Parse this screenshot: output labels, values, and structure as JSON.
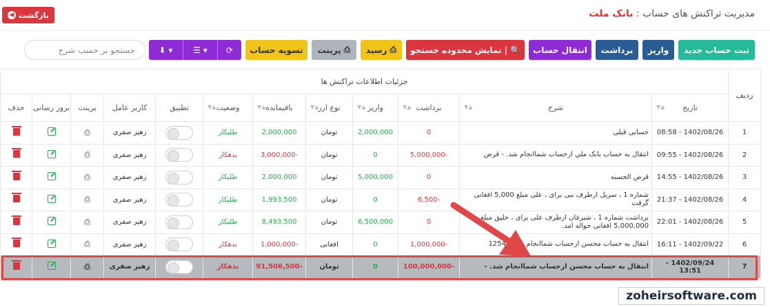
{
  "header": {
    "title_prefix": "مدیریت تراکنش های حساب :",
    "bank_name": "بانک ملت",
    "back_label": "بازگشت"
  },
  "toolbar": {
    "new_account": "ثبت حساب جدید",
    "deposit": "واریز",
    "withdraw": "برداشت",
    "transfer": "انتقال حساب",
    "search_range": "نمایش محدوده جستجو",
    "receipt": "رسید",
    "print": "پرینت",
    "settle": "تسویه حساب",
    "search_placeholder": "جستجو بر حسب شرح"
  },
  "table": {
    "caption": "جزئیات اطلاعات تراکنش ها",
    "columns": {
      "row": "ردیف",
      "date": "تاریخ",
      "description": "شرح",
      "withdraw": "برداشت",
      "deposit": "واریز",
      "currency": "نوع ارز",
      "balance": "باقیمانده",
      "status": "وضعیت",
      "reconcile": "تطبیق",
      "operator": "کاربر عامل",
      "print": "پرینت",
      "update": "بروز رسانی",
      "delete": "حذف"
    },
    "rows": [
      {
        "id": "1",
        "date": "1402/08/26 - 08:58",
        "desc": "حسابی قبلی",
        "withdraw": "0",
        "deposit": "2,000,000",
        "currency": "تومان",
        "balance": "2,000,000",
        "status": "طلبکار",
        "operator": "زهیر صفری"
      },
      {
        "id": "2",
        "date": "1402/08/26 - 09:55",
        "desc": "انتقال به حساب بانک ملي ازحساب شماانجام شد. - قرض",
        "withdraw": "-5,000,000",
        "deposit": "0",
        "currency": "تومان",
        "balance": "-3,000,000",
        "status": "بدهکار",
        "operator": "زهیر صفری"
      },
      {
        "id": "3",
        "date": "1402/08/26 - 14:55",
        "desc": "قرض الحسنه",
        "withdraw": "0",
        "deposit": "5,000,000",
        "currency": "تومان",
        "balance": "2,000,000",
        "status": "طلبکار",
        "operator": "زهیر صفری"
      },
      {
        "id": "4",
        "date": "1402/08/26 - 21:37",
        "desc": "شماره 1 ، سربل ازطرف نبی برای ، علی مبلغ 5,000 افغانی گرفت",
        "withdraw": "-6,500",
        "deposit": "0",
        "currency": "تومان",
        "balance": "1,993,500",
        "status": "طلبکار",
        "operator": "زهیر صفری"
      },
      {
        "id": "5",
        "date": "1402/08/26 - 22:01",
        "desc": "برداشت شماره 1 ، شبرغان ازطرف علی برای ، خلیق مبلغ 5,000,000 افغانی حواله امد.",
        "withdraw": "0",
        "deposit": "6,500,000",
        "currency": "تومان",
        "balance": "8,493,500",
        "status": "طلبکار",
        "operator": "زهیر صفری"
      },
      {
        "id": "6",
        "date": "1402/09/22 - 16:11",
        "desc": "انتقال به حساب محسن ازحساب شماانجام شد. 12542",
        "withdraw": "-1,000,000",
        "deposit": "0",
        "currency": "افغانی",
        "balance": "-1,000,000",
        "status": "بدهکار",
        "operator": "زهیر صفری"
      },
      {
        "id": "7",
        "date": "1402/09/24 - 13:51",
        "desc": "انتقال به حساب محسن ازحساب شماانجام شد. -",
        "withdraw": "-100,000,000",
        "deposit": "0",
        "currency": "تومان",
        "balance": "-91,506,500",
        "status": "بدهکار",
        "operator": "زهیر صفری"
      }
    ]
  },
  "watermark": "zoheirsoftware.com",
  "colors": {
    "green": "#26b99a",
    "blue": "#2a5d93",
    "purple": "#8e2bd6",
    "red": "#d9363e",
    "yellow": "#f0c419",
    "highlight": "#e04747"
  }
}
